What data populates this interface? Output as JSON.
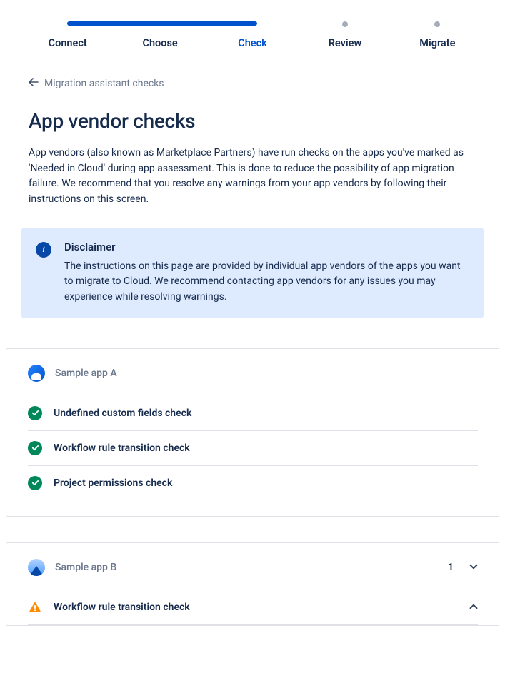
{
  "stepper": {
    "steps": [
      {
        "label": "Connect",
        "state": "done"
      },
      {
        "label": "Choose",
        "state": "done"
      },
      {
        "label": "Check",
        "state": "active"
      },
      {
        "label": "Review",
        "state": "pending"
      },
      {
        "label": "Migrate",
        "state": "pending"
      }
    ]
  },
  "back_link": {
    "label": "Migration assistant checks"
  },
  "page": {
    "title": "App vendor checks",
    "description": "App vendors (also known as Marketplace Partners) have run checks on the apps you've marked as 'Needed in Cloud' during app assessment. This is done to reduce the possibility of app migration failure. We recommend that you resolve any warnings from your app vendors by following their instructions on this screen."
  },
  "disclaimer": {
    "title": "Disclaimer",
    "body": "The instructions on this page are provided by individual app vendors of the apps you want to migrate to Cloud.  We recommend contacting app vendors for any issues you may experience while resolving warnings."
  },
  "apps": [
    {
      "name": "Sample app A",
      "avatar": "blue",
      "count": null,
      "expanded": false,
      "checks": [
        {
          "label": "Undefined custom fields check",
          "status": "success"
        },
        {
          "label": "Workflow rule transition check",
          "status": "success"
        },
        {
          "label": "Project permissions check",
          "status": "success"
        }
      ]
    },
    {
      "name": "Sample app B",
      "avatar": "mtn",
      "count": "1",
      "expanded": true,
      "checks": [
        {
          "label": "Workflow rule transition check",
          "status": "warning"
        }
      ]
    }
  ]
}
